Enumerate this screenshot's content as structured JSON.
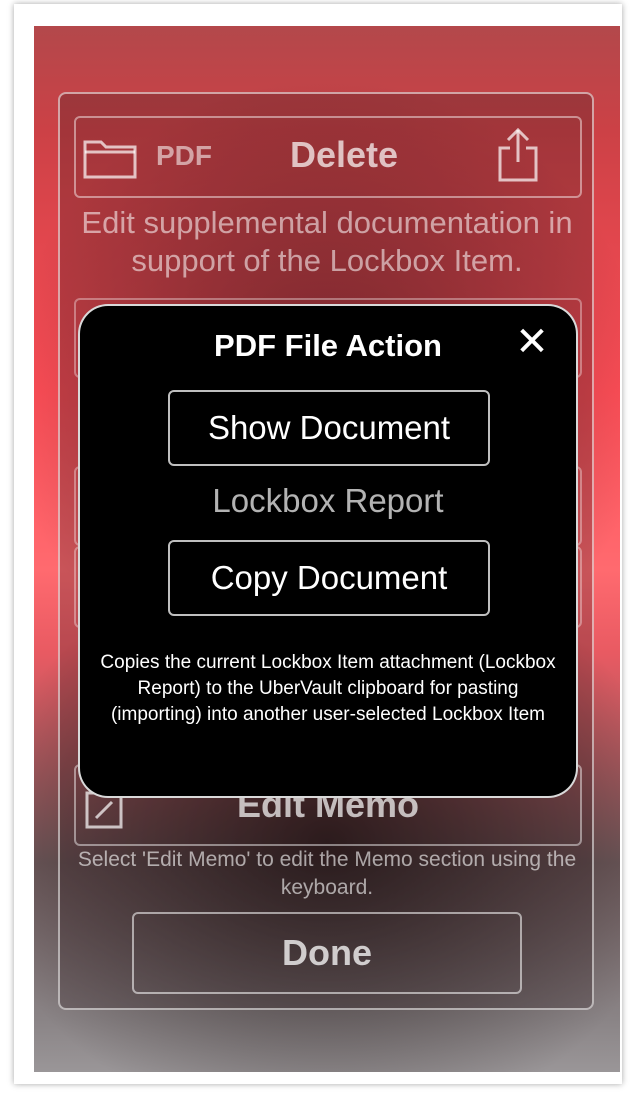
{
  "toolbar": {
    "pdf_label": "PDF",
    "delete_label": "Delete",
    "hint": "Edit supplemental documentation in support of the Lockbox Item."
  },
  "memo": {
    "edit_label": "Edit Memo",
    "hint": "Select 'Edit Memo' to edit the Memo section using the keyboard."
  },
  "done_label": "Done",
  "modal": {
    "title": "PDF File Action",
    "close_glyph": "✕",
    "show_button": "Show Document",
    "document_name": "Lockbox Report",
    "copy_button": "Copy Document",
    "description": "Copies the current Lockbox Item attachment (Lockbox Report) to the UberVault clipboard for pasting (importing) into another user-selected Lockbox Item"
  }
}
